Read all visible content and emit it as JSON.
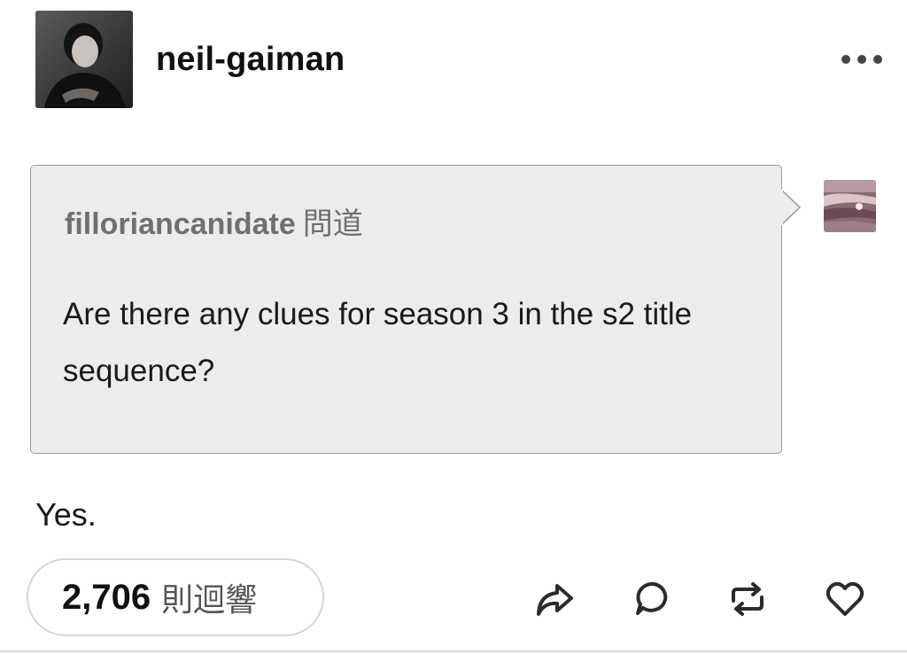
{
  "post": {
    "blog_name": "neil-gaiman",
    "more_menu_icon": "more-horizontal-icon"
  },
  "ask": {
    "asker_name": "filloriancanidate",
    "asked_suffix": "問道",
    "question": "Are there any clues for season 3 in the s2 title sequence?"
  },
  "answer": {
    "text": "Yes."
  },
  "footer": {
    "notes_count": "2,706",
    "notes_label": "則迴響",
    "actions": [
      "share-icon",
      "reply-icon",
      "reblog-icon",
      "like-icon"
    ]
  },
  "colors": {
    "ask_background": "#ececec",
    "ask_border": "#9a9a9a",
    "asker_text": "#707070",
    "icon": "#2b2b2b"
  }
}
